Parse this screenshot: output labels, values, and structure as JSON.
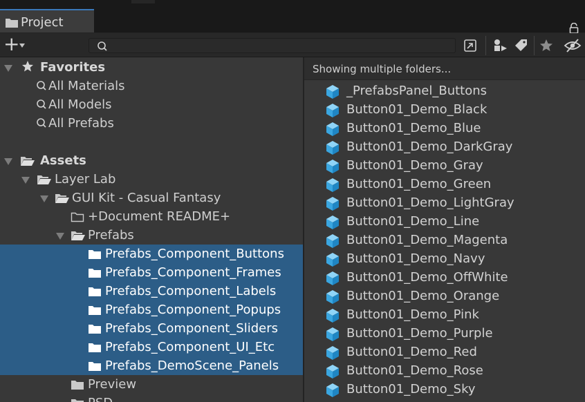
{
  "window": {
    "tab_label": "Project"
  },
  "toolbar": {
    "add_label": "+",
    "search_value": "",
    "search_placeholder": ""
  },
  "tree": {
    "favorites": {
      "label": "Favorites",
      "items": [
        "All Materials",
        "All Models",
        "All Prefabs"
      ]
    },
    "assets": {
      "label": "Assets",
      "layer_lab": "Layer Lab",
      "gui_kit": "GUI Kit - Casual Fantasy",
      "readme": "+Document README+",
      "prefabs": "Prefabs",
      "selected_folders": [
        "Prefabs_Component_Buttons",
        "Prefabs_Component_Frames",
        "Prefabs_Component_Labels",
        "Prefabs_Component_Popups",
        "Prefabs_Component_Sliders",
        "Prefabs_Component_UI_Etc",
        "Prefabs_DemoScene_Panels"
      ],
      "preview": "Preview",
      "psd": "PSD"
    }
  },
  "content": {
    "header": "Showing multiple folders...",
    "items": [
      "_PrefabsPanel_Buttons",
      "Button01_Demo_Black",
      "Button01_Demo_Blue",
      "Button01_Demo_DarkGray",
      "Button01_Demo_Gray",
      "Button01_Demo_Green",
      "Button01_Demo_LightGray",
      "Button01_Demo_Line",
      "Button01_Demo_Magenta",
      "Button01_Demo_Navy",
      "Button01_Demo_OffWhite",
      "Button01_Demo_Orange",
      "Button01_Demo_Pink",
      "Button01_Demo_Purple",
      "Button01_Demo_Red",
      "Button01_Demo_Rose",
      "Button01_Demo_Sky"
    ]
  },
  "colors": {
    "selection": "#2c5d87",
    "tab_accent": "#3a79bb",
    "prefab_icon": "#4fb3e8",
    "panel_bg": "#383838"
  },
  "icons": {
    "lock": "lock-icon",
    "search": "search-icon",
    "folder": "folder-icon",
    "prefab": "prefab-cube-icon"
  }
}
